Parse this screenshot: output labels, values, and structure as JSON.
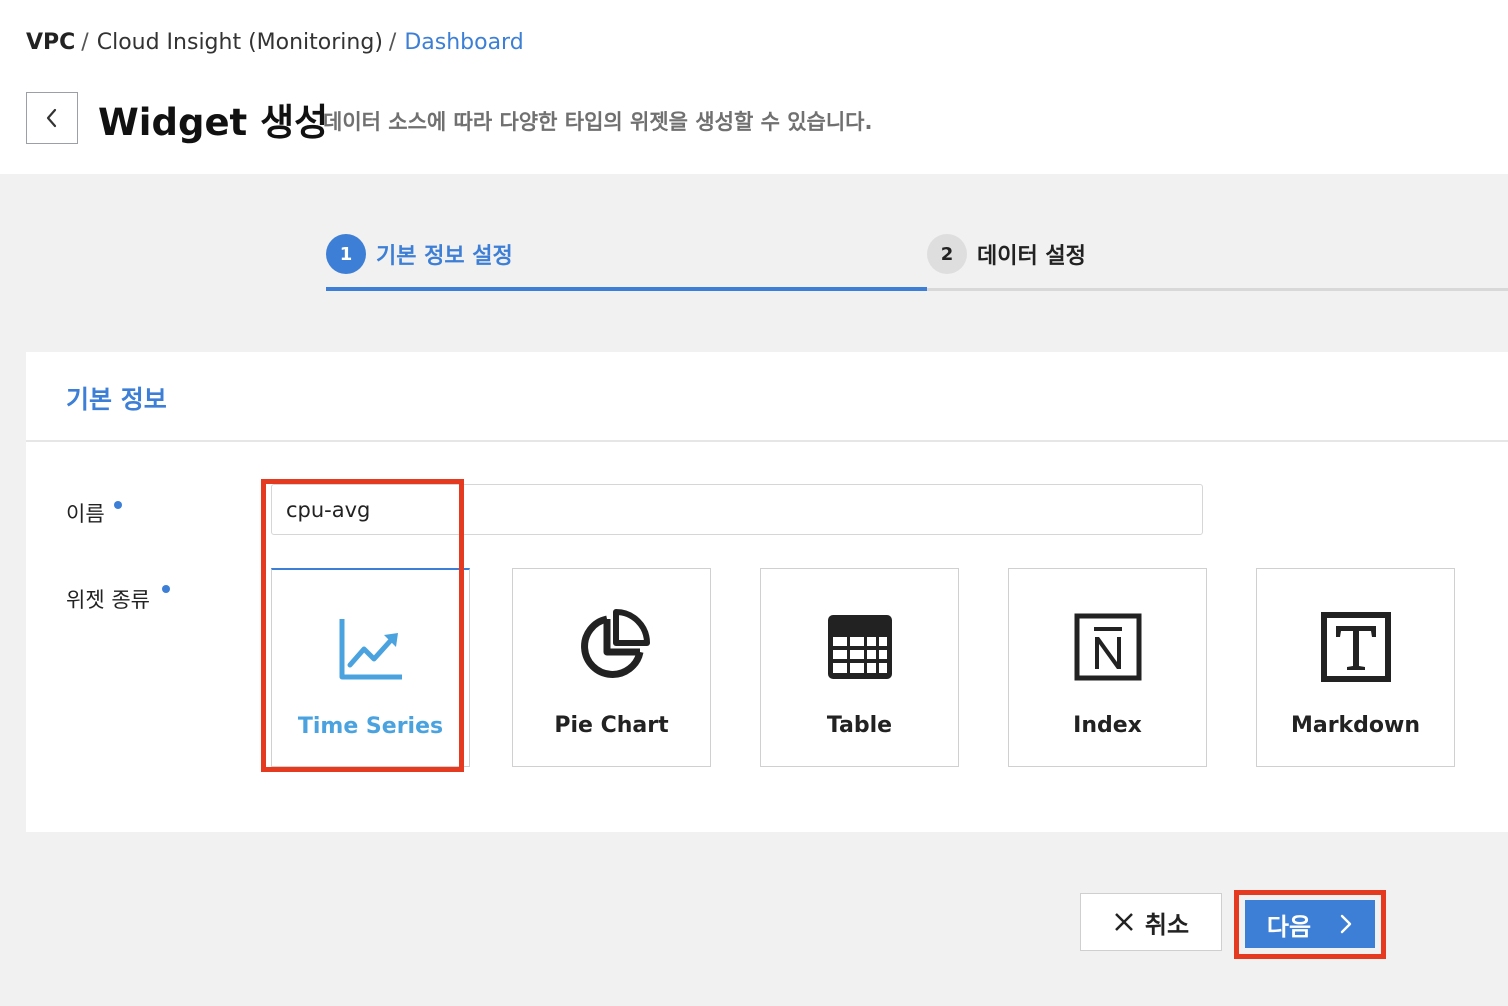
{
  "breadcrumb": {
    "items": [
      "VPC",
      "Cloud Insight (Monitoring)",
      "Dashboard"
    ],
    "separator": "/"
  },
  "header": {
    "title": "Widget 생성",
    "description": "데이터 소스에 따라 다양한 타입의 위젯을 생성할 수 있습니다."
  },
  "steps": [
    {
      "number": "1",
      "label": "기본 정보 설정",
      "active": true
    },
    {
      "number": "2",
      "label": "데이터 설정",
      "active": false
    }
  ],
  "section": {
    "title": "기본 정보"
  },
  "form": {
    "name_label": "이름",
    "name_value": "cpu-avg",
    "widget_type_label": "위젯 종류"
  },
  "widget_types": [
    {
      "label": "Time Series",
      "icon": "time-series-chart-icon",
      "selected": true
    },
    {
      "label": "Pie Chart",
      "icon": "pie-chart-icon",
      "selected": false
    },
    {
      "label": "Table",
      "icon": "table-grid-icon",
      "selected": false
    },
    {
      "label": "Index",
      "icon": "index-n-icon",
      "selected": false
    },
    {
      "label": "Markdown",
      "icon": "markdown-t-icon",
      "selected": false
    }
  ],
  "buttons": {
    "cancel": "취소",
    "next": "다음"
  },
  "colors": {
    "accent": "#3d7fd6",
    "selected_label": "#4aa3df",
    "highlight": "#e53a1f"
  }
}
